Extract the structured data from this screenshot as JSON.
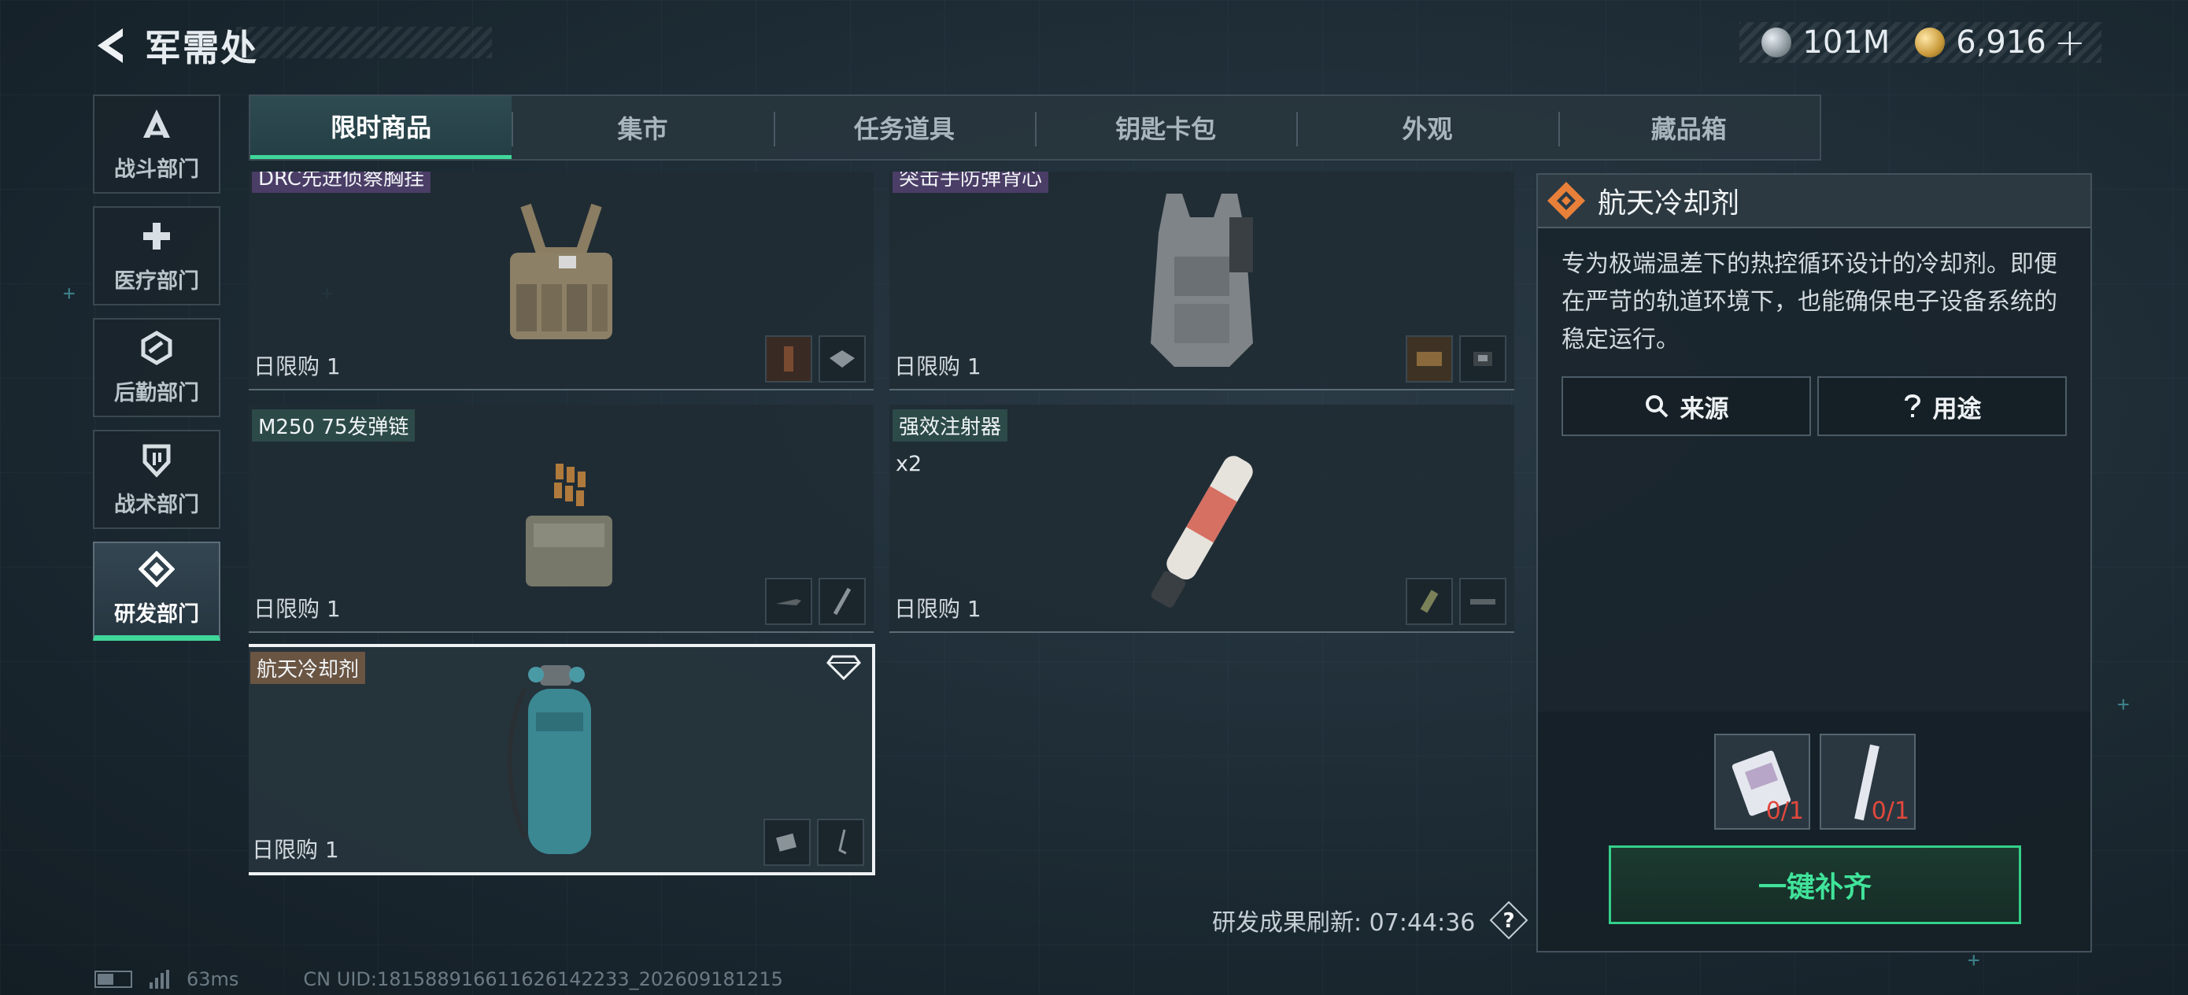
{
  "header": {
    "title": "军需处"
  },
  "currency": [
    {
      "icon": "silver-coin-icon",
      "value": "101M"
    },
    {
      "icon": "gold-coin-icon",
      "value": "6,916"
    }
  ],
  "currency_plus": "+",
  "sidebar": {
    "items": [
      {
        "label": "战斗部门",
        "icon": "combat-dept-icon"
      },
      {
        "label": "医疗部门",
        "icon": "medical-cross-icon"
      },
      {
        "label": "后勤部门",
        "icon": "logistics-hex-icon"
      },
      {
        "label": "战术部门",
        "icon": "tactical-shield-icon"
      },
      {
        "label": "研发部门",
        "icon": "research-diamond-icon",
        "active": true
      }
    ]
  },
  "tabs": [
    {
      "label": "限时商品",
      "active": true
    },
    {
      "label": "集市"
    },
    {
      "label": "任务道具"
    },
    {
      "label": "钥匙卡包"
    },
    {
      "label": "外观"
    },
    {
      "label": "藏品箱"
    }
  ],
  "items": [
    {
      "name": "DRC先进侦察胸挂",
      "limit": "日限购 1",
      "tag": "purple"
    },
    {
      "name": "突击手防弹背心",
      "limit": "日限购 1",
      "tag": "purple"
    },
    {
      "name": "M250 75发弹链",
      "limit": "日限购 1",
      "tag": "green"
    },
    {
      "name": "强效注射器",
      "qty": "x2",
      "limit": "日限购 1",
      "tag": "green"
    },
    {
      "name": "航天冷却剂",
      "limit": "日限购 1",
      "tag": "brown",
      "selected": true
    }
  ],
  "refresh": {
    "label": "研发成果刷新:",
    "time": "07:44:36",
    "help": "?"
  },
  "detail": {
    "title": "航天冷却剂",
    "description": "专为极端温差下的热控循环设计的冷却剂。即便在严苛的轨道环境下，也能确保电子设备系统的稳定运行。",
    "source_label": "来源",
    "usage_label": "用途",
    "requirements": [
      {
        "icon": "circuit-card-icon",
        "count": "0/1"
      },
      {
        "icon": "metal-rod-icon",
        "count": "0/1"
      }
    ],
    "fill_button": "一键补齐"
  },
  "footer": {
    "ping": "63ms",
    "uid": "CN UID:181588916611626142233_202609181215"
  },
  "colors": {
    "accent": "#3fd79a",
    "warning": "#e2483d",
    "orange": "#e8803a"
  }
}
